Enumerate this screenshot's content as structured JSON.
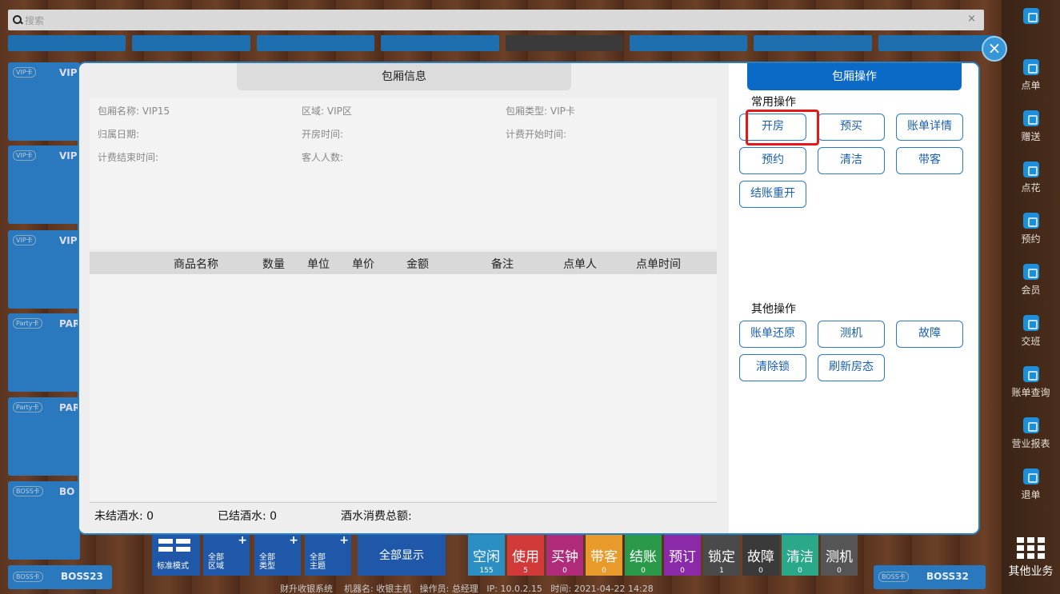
{
  "search": {
    "placeholder": "搜索",
    "clear": "×"
  },
  "background_rooms": [
    {
      "tag": "VIP卡",
      "name": "VIP"
    },
    {
      "tag": "VIP卡",
      "name": "VIP"
    },
    {
      "tag": "VIP卡",
      "name": "VIP"
    },
    {
      "tag": "Party卡",
      "name": "PAR"
    },
    {
      "tag": "Party卡",
      "name": "PAR"
    },
    {
      "tag": "BOSS卡",
      "name": "BO"
    }
  ],
  "bottom_rooms": [
    {
      "tag": "BOSS卡",
      "name": "BOSS23"
    },
    {
      "tag": "BOSS卡",
      "name": "BOSS32"
    }
  ],
  "toolbar": {
    "standard_mode": "标准模式",
    "all_area": "全部\n区域",
    "all_type": "全部\n类型",
    "all_theme": "全部\n主题",
    "show_all": "全部显示",
    "plus": "+",
    "statuses": [
      {
        "label": "空闲",
        "count": "155",
        "color": "#2c8fc4"
      },
      {
        "label": "使用",
        "count": "5",
        "color": "#d23a3a"
      },
      {
        "label": "买钟",
        "count": "0",
        "color": "#b02b7a"
      },
      {
        "label": "带客",
        "count": "0",
        "color": "#e89a2a"
      },
      {
        "label": "结账",
        "count": "0",
        "color": "#2a9a4a"
      },
      {
        "label": "预订",
        "count": "0",
        "color": "#8a2aa8"
      },
      {
        "label": "锁定",
        "count": "1",
        "color": "#4a4a4a"
      },
      {
        "label": "故障",
        "count": "0",
        "color": "#3a3a3a"
      },
      {
        "label": "清洁",
        "count": "0",
        "color": "#2aa88a"
      },
      {
        "label": "测机",
        "count": "0",
        "color": "#555555"
      }
    ]
  },
  "footer": "财升收银系统    机器名: 收银主机   操作员: 总经理   IP: 10.0.2.15   时间: 2021-04-22 14:28",
  "sidebar": [
    {
      "label": ""
    },
    {
      "label": "点单"
    },
    {
      "label": "赠送"
    },
    {
      "label": "点花"
    },
    {
      "label": "预约"
    },
    {
      "label": "会员"
    },
    {
      "label": "交班"
    },
    {
      "label": "账单查询"
    },
    {
      "label": "营业报表"
    },
    {
      "label": "退单"
    }
  ],
  "sidebar_more": "其他业务",
  "modal": {
    "info_title": "包厢信息",
    "fields": {
      "room_name": "包厢名称: VIP15",
      "area": "区域: VIP区",
      "room_type": "包厢类型: VIP卡",
      "belong_date": "归属日期:",
      "open_time": "开房时间:",
      "billing_start": "计费开始时间:",
      "billing_end": "计费结束时间:",
      "guest_count": "客人人数:"
    },
    "table_headers": [
      "商品名称",
      "数量",
      "单位",
      "单价",
      "金额",
      "备注",
      "点单人",
      "点单时间"
    ],
    "summary": {
      "unsettled": "未结酒水: 0",
      "settled": "已结酒水: 0",
      "total": "酒水消费总额:"
    },
    "op_title": "包厢操作",
    "common_title": "常用操作",
    "common_ops": [
      "开房",
      "预买",
      "账单详情",
      "预约",
      "清洁",
      "带客",
      "结账重开"
    ],
    "other_title": "其他操作",
    "other_ops": [
      "账单还原",
      "测机",
      "故障",
      "清除锁",
      "刷新房态"
    ],
    "close": "×"
  }
}
